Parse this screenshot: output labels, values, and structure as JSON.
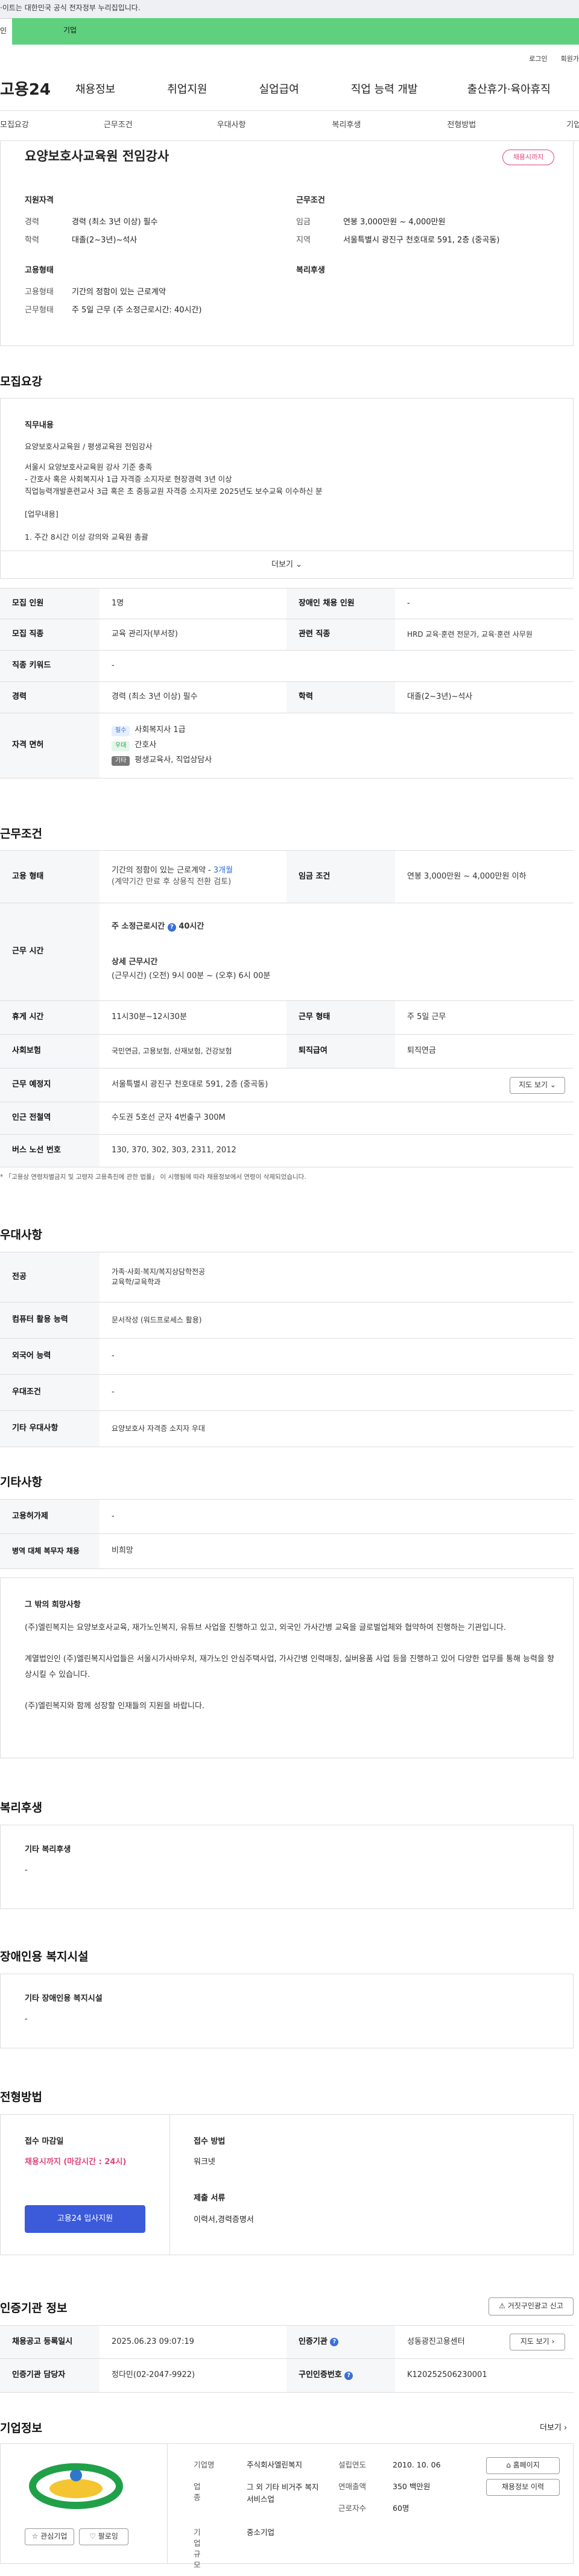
{
  "notice": "·이트는 대한민국 공식 전자정부 누리집입니다.",
  "tabs": {
    "individual": "인",
    "corporate": "기업"
  },
  "util": {
    "login": "로그인",
    "join": "회원가"
  },
  "gnb": {
    "logo": "고용24",
    "menu": [
      "채용정보",
      "취업지원",
      "실업급여",
      "직업 능력 개발",
      "출산휴가·육아휴직"
    ]
  },
  "subnav": [
    "모집요강",
    "근무조건",
    "우대사항",
    "복리후생",
    "전형방법",
    "기업정보"
  ],
  "job": {
    "title": "요양보호사교육원 전임강사",
    "badge": "채용시까지",
    "qual_head": "지원자격",
    "career_label": "경력",
    "career": "경력 (최소 3년 이상) 필수",
    "edu_label": "학력",
    "edu": "대졸(2~3년)~석사",
    "cond_head": "근무조건",
    "wage_label": "임금",
    "wage": "연봉 3,000만원 ~ 4,000만원",
    "loc_label": "지역",
    "loc": "서울특별시 광진구 천호대로 591, 2층 (중곡동)",
    "emp_head": "고용형태",
    "etype_label": "고용형태",
    "etype": "기간의 정함이 있는 근로계약",
    "wtime_label": "근무형태",
    "wtime": "주 5일 근무 (주 소정근로시간: 40시간)",
    "welfare_head": "복리후생"
  },
  "recruit": {
    "title": "모집요강",
    "duty_head": "직무내용",
    "lines": [
      "요양보호사교육원 / 평생교육원 전임강사",
      "서울시 요양보호사교육원 강사 기준 충족",
      "- 간호사 혹은 사회복지사 1급 자격증 소지자로 현장경력 3년 이상",
      "직업능력개발훈련교사 3급 혹은 초 중등교원 자격증 소지자로 2025년도 보수교육 이수하신 분",
      "[업무내용]",
      "1. 주간 8시간 이상 강의와 교육원 총괄"
    ],
    "more": "더보기"
  },
  "rtable": {
    "r1": [
      "모집 인원",
      "1명",
      "장애인 채용 인원",
      "-"
    ],
    "r2": [
      "모집 직종",
      "교육 관리자(부서장)",
      "관련 직종",
      "HRD 교육·훈련 전문가, 교육·훈련 사무원"
    ],
    "r3": [
      "직종 키워드",
      "-"
    ],
    "r4": [
      "경력",
      "경력 (최소 3년 이상) 필수",
      "학력",
      "대졸(2~3년)~석사"
    ],
    "r5": {
      "th": "자격 면허",
      "items": [
        {
          "tag": "필수",
          "name": "사회복지사 1급"
        },
        {
          "tag": "우대",
          "name": "간호사"
        },
        {
          "tag": "기타",
          "name": "평생교육사, 직업상담사"
        }
      ]
    }
  },
  "cond": {
    "title": "근무조건",
    "emp_th": "고용 형태",
    "emp_td": "기간의 정함이 있는 근로계약 - ",
    "emp_months": "3개월",
    "emp_note": "(계약기간 만료 후 상용직 전환 검토)",
    "wage_th": "임금 조건",
    "wage_td": "연봉 3,000만원 ~ 4,000만원 이하",
    "time_th": "근무 시간",
    "hours_title": "주 소정근로시간",
    "hours": "40시간",
    "detail_title": "상세 근무시간",
    "detail": "(근무시간) (오전) 9시 00분 ~ (오후) 6시 00분",
    "rest_th": "휴게 시간",
    "rest": "11시30분~12시30분",
    "wt_th": "근무 형태",
    "wt": "주 5일 근무",
    "ins_th": "사회보험",
    "ins": "국민연금, 고용보험, 산재보험, 건강보험",
    "ret_th": "퇴직급여",
    "ret": "퇴직연금",
    "addr_th": "근무 예정지",
    "addr": "서울특별시 광진구 천호대로 591, 2층 (중곡동)",
    "map_btn": "지도 보기",
    "sub_th": "인근 전철역",
    "sub": "수도권 5호선 군자 4번출구 300M",
    "bus_th": "버스 노선 번호",
    "bus": "130, 370, 302, 303, 2311, 2012",
    "footnote": "* 「고용상 연령차별금지 및 고령자 고용촉진에 관한 법률」 이 시행됨에 따라 채용정보에서 연령이 삭제되었습니다."
  },
  "pref": {
    "title": "우대사항",
    "major_th": "전공",
    "major": [
      "가족·사회·복지/복지상담학전공",
      "교육학/교육학과"
    ],
    "pc_th": "컴퓨터 활용 능력",
    "pc": "문서작성 (워드프로세스 활용)",
    "lang_th": "외국어 능력",
    "lang": "-",
    "cond_th": "우대조건",
    "cond": "-",
    "etc_th": "기타 우대사항",
    "etc": "요양보호사 자격증 소지자 우대"
  },
  "other": {
    "title": "기타사항",
    "dis_th": "고용허가제",
    "dis": "-",
    "mil_th": "병역 대체 복무자 채용",
    "mil": "비희망",
    "talent_head": "그 밖의 희망사항",
    "p1": "(주)엘린복지는 요양보호사교육, 재가노인복지, 유튜브 사업을 진행하고 있고, 외국인 가사간병 교육을 글로벌업체와 협약하여 진행하는 기관입니다.",
    "p2": "계열법인인 (주)엘린복지사업들은 서울시가사바우처, 재가노인 안심주택사업, 가사간병 인력매칭, 실버용품 사업 등을 진행하고 있어 다양한 업무를 통해 능력을 향상시킬 수 있습니다.",
    "p3": "(주)엘린복지와 함께 성장할 인재들의 지원을 바랍니다."
  },
  "welfare": {
    "title": "복리후생",
    "head": "기타 복리후생",
    "val": "-"
  },
  "facility": {
    "title": "장애인용 복지시설",
    "head": "기타 장애인용 복지시설",
    "val": "-"
  },
  "method": {
    "title": "전형방법",
    "deadline_head": "접수 마감일",
    "deadline": "채용시까지 (마감시간 : 24시)",
    "apply_btn": "고용24 입사지원",
    "how_head": "접수 방법",
    "how": "워크넷",
    "docs_head": "제출 서류",
    "docs": "이력서,경력증명서"
  },
  "agency": {
    "title": "인증기관 정보",
    "report_btn": "거짓구인광고 신고",
    "reg_th": "채용공고 등록일시",
    "reg": "2025.06.23 09:07:19",
    "org_th": "인증기관",
    "org": "성동광진고용센터",
    "map_btn": "지도 보기",
    "mgr_th": "인증기관 담당자",
    "mgr": "정다민(02-2047-9922)",
    "no_th": "구인인증번호",
    "no": "K120252506230001"
  },
  "company": {
    "title": "기업정보",
    "more": "더보기",
    "fav": "관심기업",
    "follow": "팔로잉",
    "name_label": "기업명",
    "name": "주식회사엘린복지",
    "year_label": "설립연도",
    "year": "2010. 10. 06",
    "biz_label": "업종",
    "biz": "그 외 기타 비거주 복지 서비스업",
    "sales_label": "연매출액",
    "sales": "350 백만원",
    "emp_label": "근로자수",
    "emp": "60명",
    "scale_label": "기업규모",
    "scale": "중소기업",
    "home_btn": "홈페이지",
    "jobs_btn": "채용정보 이력",
    "brand": "#21a04a"
  }
}
